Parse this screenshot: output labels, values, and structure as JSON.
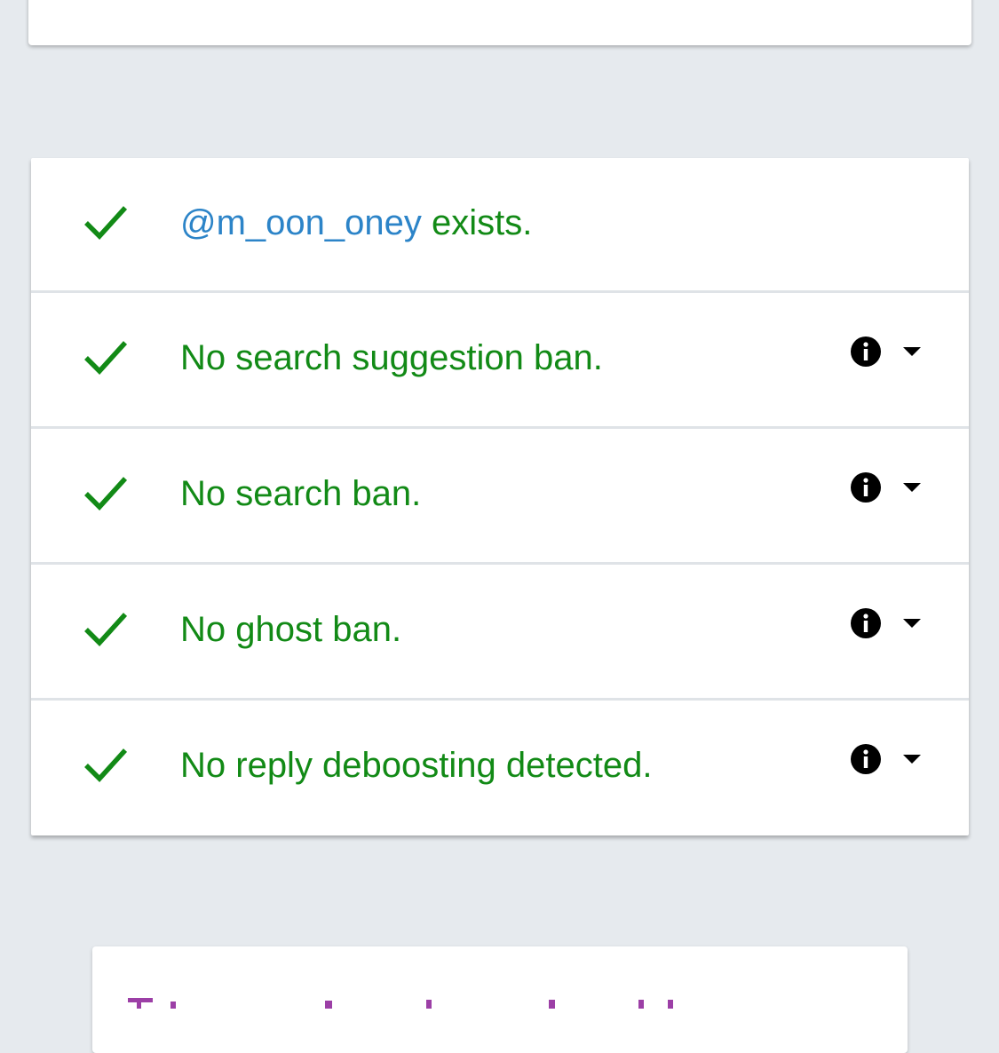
{
  "colors": {
    "page_background": "#e6eaee",
    "card_background": "#ffffff",
    "success_green": "#128a16",
    "handle_blue": "#2c84c8",
    "icon_black": "#000000",
    "divider": "#dfe3e7",
    "partial_heading_purple": "#9c3fa6"
  },
  "results": {
    "rows": [
      {
        "status_icon": "check-icon",
        "handle": "@m_oon_oney",
        "label": " exists.",
        "has_details": false
      },
      {
        "status_icon": "check-icon",
        "label": "No search suggestion ban.",
        "info_icon": "info-icon",
        "toggle_icon": "caret-down-icon",
        "has_details": true
      },
      {
        "status_icon": "check-icon",
        "label": "No search ban.",
        "info_icon": "info-icon",
        "toggle_icon": "caret-down-icon",
        "has_details": true
      },
      {
        "status_icon": "check-icon",
        "label": "No ghost ban.",
        "info_icon": "info-icon",
        "toggle_icon": "caret-down-icon",
        "has_details": true
      },
      {
        "status_icon": "check-icon",
        "label": "No reply deboosting detected.",
        "info_icon": "info-icon",
        "toggle_icon": "caret-down-icon",
        "has_details": true
      }
    ]
  }
}
